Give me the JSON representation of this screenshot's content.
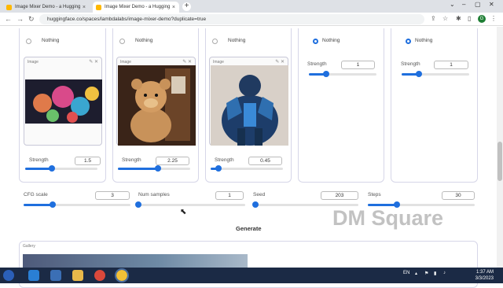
{
  "browser": {
    "tabs": [
      {
        "title": "Image Mixer Demo - a Hugging",
        "close": "×"
      },
      {
        "title": "Image Mixer Demo - a Hugging",
        "close": "×"
      }
    ],
    "new_tab": "+",
    "url": "huggingface.co/spaces/lambdalabs/image-mixer-demo?duplicate=true",
    "profile_initial": "G"
  },
  "panels": [
    {
      "radio_label": "Nothing",
      "selected": false,
      "image_label": "Image",
      "strength_label": "Strength",
      "strength_value": "1.5",
      "slider_fraction": 0.37
    },
    {
      "radio_label": "Nothing",
      "selected": false,
      "image_label": "Image",
      "strength_label": "Strength",
      "strength_value": "2.25",
      "slider_fraction": 0.55
    },
    {
      "radio_label": "Nothing",
      "selected": false,
      "image_label": "Image",
      "strength_label": "Strength",
      "strength_value": "0.45",
      "slider_fraction": 0.11
    },
    {
      "radio_label": "Nothing",
      "selected": true,
      "strength_label": "Strength",
      "strength_value": "1",
      "slider_fraction": 0.25
    },
    {
      "radio_label": "Nothing",
      "selected": true,
      "strength_label": "Strength",
      "strength_value": "1",
      "slider_fraction": 0.25
    }
  ],
  "controls": {
    "cfg": {
      "label": "CFG scale",
      "value": "3",
      "fraction": 0.27
    },
    "samples": {
      "label": "Num samples",
      "value": "1",
      "fraction": 0.0
    },
    "seed": {
      "label": "Seed",
      "value": "203",
      "fraction": 0.02
    },
    "steps": {
      "label": "Steps",
      "value": "30",
      "fraction": 0.27
    }
  },
  "watermark": "DM Square",
  "generate_label": "Generate",
  "gallery_label": "Gallery",
  "taskbar": {
    "lang": "EN",
    "time": "1:37 AM",
    "date": "3/3/2023"
  },
  "colors": {
    "accent": "#1f6fde",
    "taskbar": "#1b2a45"
  }
}
